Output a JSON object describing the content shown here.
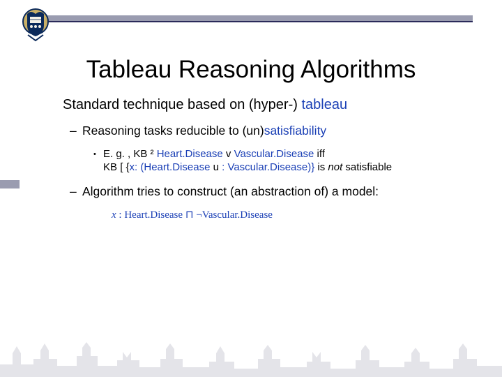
{
  "title": "Tableau Reasoning Algorithms",
  "bullet0_pre": "Standard technique based on (hyper-) ",
  "bullet0_hl": "tableau",
  "bullet1_pre": "Reasoning tasks reducible to (un)",
  "bullet1_hl": "satisfiability",
  "bullet2_a": "E. g. , KB ",
  "bullet2_sym1": "²",
  "bullet2_b": " Heart.Disease ",
  "bullet2_sym2": "v",
  "bullet2_c": " Vascular.Disease",
  "bullet2_d": " iff",
  "bullet2_e": "KB ",
  "bullet2_sym3": "[",
  "bullet2_f": " {",
  "bullet2_x": "x",
  "bullet2_g": ": (Heart.Disease ",
  "bullet2_sym4": "u",
  "bullet2_h": " : Vascular.Disease)}",
  "bullet2_i": " is ",
  "bullet2_not": "not",
  "bullet2_j": " satisfiable",
  "bullet3": "Algorithm tries to construct (an abstraction of) a model:",
  "formula_x": "x",
  "formula_colon": " : ",
  "formula_hd": "Heart.Disease",
  "formula_op": " ⊓ ¬",
  "formula_vd": "Vascular.Disease"
}
